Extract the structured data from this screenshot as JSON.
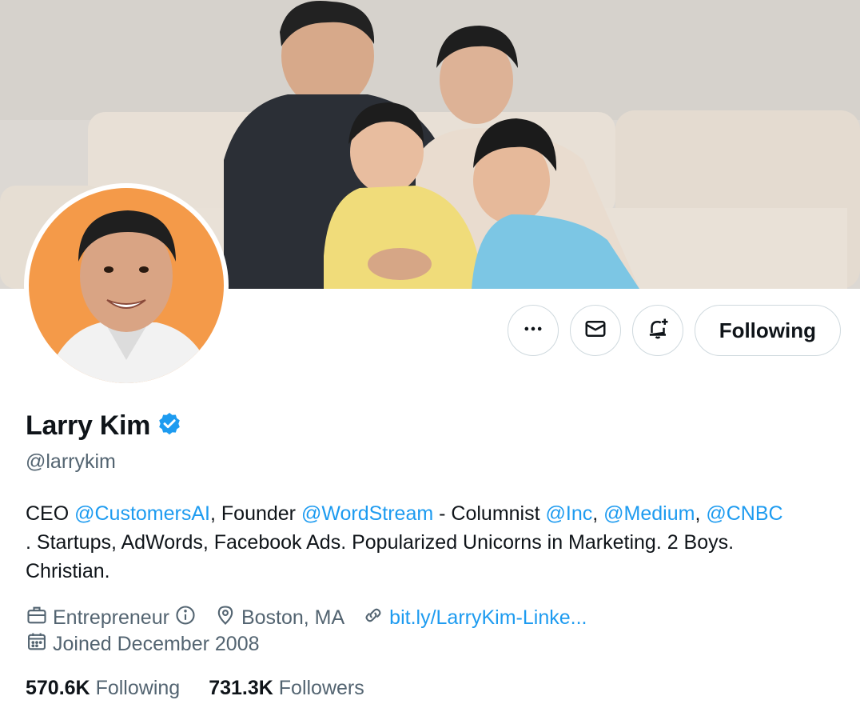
{
  "profile": {
    "name": "Larry Kim",
    "handle": "@larrykim",
    "verified": true,
    "verified_color": "#1d9bf0"
  },
  "actions": {
    "more_icon": "more-icon",
    "message_icon": "mail-icon",
    "notify_icon": "bell-plus-icon",
    "follow_label": "Following"
  },
  "bio": {
    "line1": {
      "t1": "CEO ",
      "m1": "@CustomersAI",
      "t2": ", Founder ",
      "m2": "@WordStream",
      "t3": " - Columnist ",
      "m3": "@Inc",
      "t4": ", ",
      "m4": "@Medium",
      "t5": ", ",
      "m5": "@CNBC"
    },
    "line2": ". Startups, AdWords, Facebook Ads. Popularized Unicorns in Marketing. 2 Boys.",
    "line3": "Christian."
  },
  "meta": {
    "category": "Entrepreneur",
    "location": "Boston, MA",
    "website": "bit.ly/LarryKim-Linke...",
    "joined": "Joined December 2008"
  },
  "stats": {
    "following_count": "570.6K",
    "following_label": "Following",
    "followers_count": "731.3K",
    "followers_label": "Followers"
  },
  "colors": {
    "accent": "#1d9bf0",
    "text": "#0f1419",
    "secondary": "#536471",
    "border": "#cfd9de"
  }
}
